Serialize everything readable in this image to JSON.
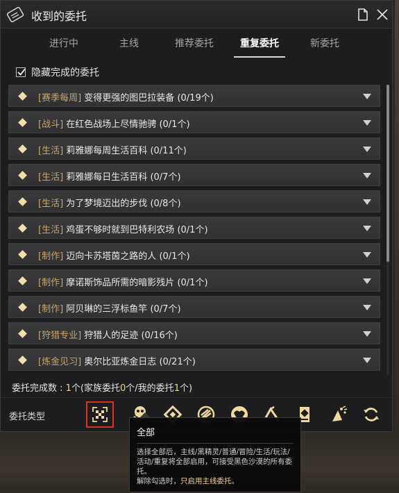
{
  "window": {
    "title": "收到的委托"
  },
  "tabs": [
    {
      "label": "进行中",
      "active": false
    },
    {
      "label": "主线",
      "active": false
    },
    {
      "label": "推荐委托",
      "active": false
    },
    {
      "label": "重复委托",
      "active": true
    },
    {
      "label": "新委托",
      "active": false
    }
  ],
  "hide_completed": {
    "label": "隐藏完成的委托",
    "checked": true
  },
  "quests": [
    {
      "category": "[赛季每周]",
      "name": "变得更强的图巴拉装备",
      "progress": "(0/19个)"
    },
    {
      "category": "[战斗]",
      "name": "在红色战场上尽情驰骋",
      "progress": "(0/1个)"
    },
    {
      "category": "[生活]",
      "name": "莉雅娜每周生活百科",
      "progress": "(0/11个)"
    },
    {
      "category": "[生活]",
      "name": "莉雅娜每日生活百科",
      "progress": "(0/7个)"
    },
    {
      "category": "[生活]",
      "name": "为了梦境迈出的步伐",
      "progress": "(0/8个)"
    },
    {
      "category": "[生活]",
      "name": "鸡蛋不够时就到巴特利农场",
      "progress": "(0/1个)"
    },
    {
      "category": "[制作]",
      "name": "迈向卡苏塔茵之路的人",
      "progress": "(0/1个)"
    },
    {
      "category": "[制作]",
      "name": "摩诺斯饰品所需的暗影残片",
      "progress": "(0/1个)"
    },
    {
      "category": "[制作]",
      "name": "阿贝琳的三浮标鱼竿",
      "progress": "(0/7个)"
    },
    {
      "category": "[狩猎专业]",
      "name": "狩猎人的足迹",
      "progress": "(0/16个)"
    },
    {
      "category": "[炼金见习]",
      "name": "奥尔比亚炼金日志",
      "progress": "(0/21个)"
    }
  ],
  "completion": {
    "label": "委托完成数 : ",
    "count": "1",
    "mid": "个(家族委托",
    "family": "0",
    "mine_label": "个/我的委托",
    "mine": "1",
    "end": "个)"
  },
  "type_filter": {
    "label": "委托类型",
    "icons": [
      "all-icon",
      "black-spirit-icon",
      "normal-quest-icon",
      "adventure-icon",
      "life-icon",
      "pvp-icon",
      "repeat-scroll-icon",
      "event-icon",
      "reset-icon"
    ]
  },
  "tooltip": {
    "title": "全部",
    "body": "选择全部后，主线/黑精灵/普通/冒险/生活/玩法/活动/重复将全部启用，可接受黑色沙漠的所有委托。",
    "body2_prefix": "解除勾选时，",
    "body2_emphasis": "只启用主线委托",
    "body2_suffix": "。"
  },
  "colors": {
    "accent_gold": "#f5d58c",
    "category_gold": "#c8a56a",
    "selected_red": "#e0321f",
    "diamond": "#f0dfae"
  }
}
